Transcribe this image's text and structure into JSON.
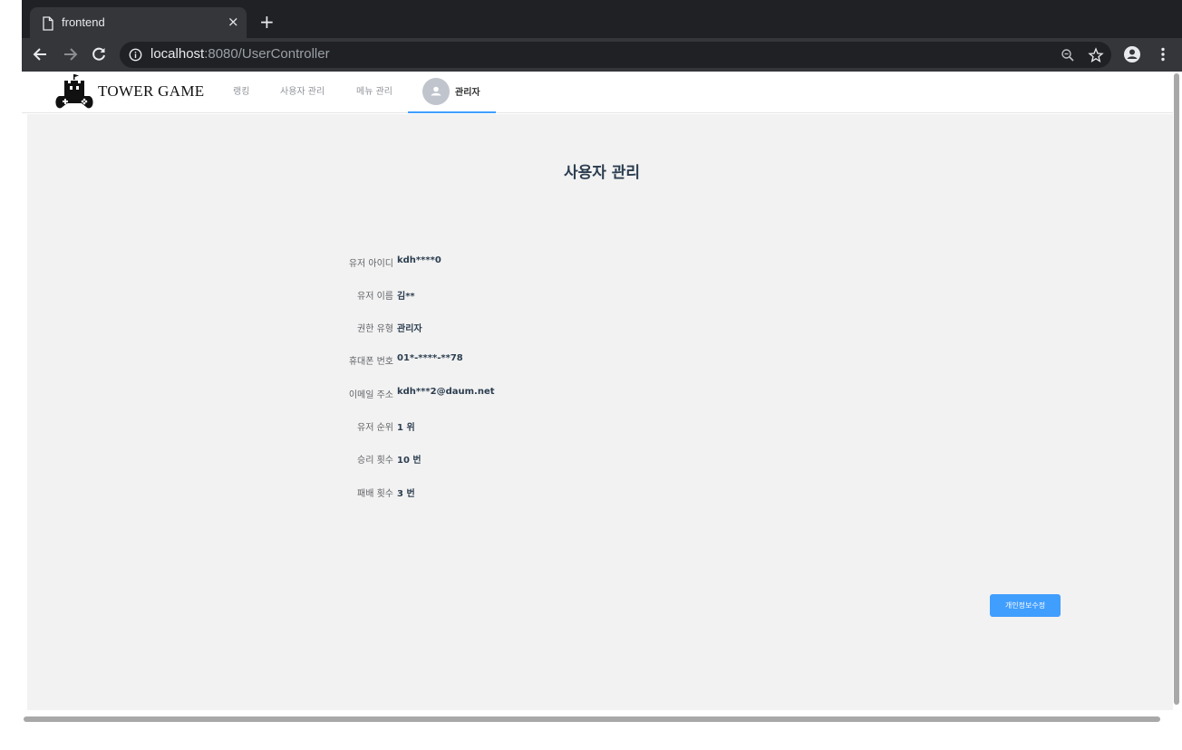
{
  "browser": {
    "tab_title": "frontend",
    "tab_close": "×",
    "new_tab": "+",
    "url_host": "localhost",
    "url_rest": ":8080/UserController"
  },
  "header": {
    "brand": "TOWER GAME",
    "nav": [
      "랭킹",
      "사용자 관리",
      "메뉴 관리"
    ],
    "active": "관리자"
  },
  "page": {
    "title": "사용자 관리",
    "fields": [
      {
        "label": "유저 아이디",
        "value": "kdh****0"
      },
      {
        "label": "유저 이름",
        "value": "김**"
      },
      {
        "label": "권한 유형",
        "value": "관리자"
      },
      {
        "label": "휴대폰 번호",
        "value": "01*-****-**78"
      },
      {
        "label": "이메일 주소",
        "value": "kdh***2@daum.net"
      },
      {
        "label": "유저 순위",
        "value": "1 위"
      },
      {
        "label": "승리 횟수",
        "value": "10 번"
      },
      {
        "label": "패배 횟수",
        "value": "3 번"
      }
    ],
    "edit_button": "개인정보수정"
  },
  "colors": {
    "accent": "#409eff",
    "content_bg": "#f2f2f2",
    "browser_dark": "#202124",
    "browser_toolbar": "#35363a"
  }
}
